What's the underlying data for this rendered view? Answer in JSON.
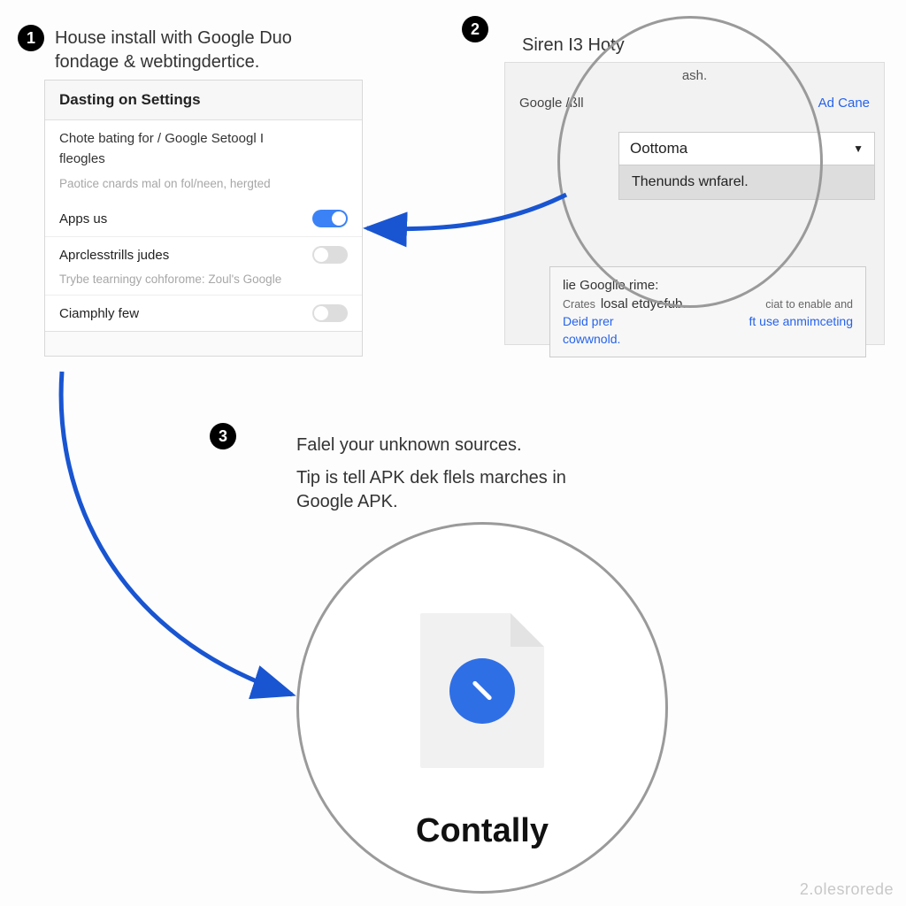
{
  "step1": {
    "badge": "1",
    "caption": "House install with Google Duo fondage & webtingdertice.",
    "panel_title": "Dasting on Settings",
    "line1": "Chote bating for / Google Setoogl I",
    "line2": "fleogles",
    "grey1": "Paotice cnards mal on fol/neen, hergted",
    "row_apps": "Apps us",
    "row_apr": "Aprclesstrills judes",
    "grey2": "Trybe tearningy cohforome: Zoul's Google",
    "row_ciam": "Ciamphly few"
  },
  "step2": {
    "badge": "2",
    "caption": "Siren I3 Hoty",
    "sub_ash": "ash.",
    "left_label": "Google /ßll",
    "right_link": "Ad Cane",
    "dropdown_value": "Oottoma",
    "dropdown_menu": "Thenunds wnfarel.",
    "box_title1": "lie Googlle rime:",
    "box_crates": "Crates",
    "box_title2": "losal etdyefub.",
    "box_enable": "ciat to enable and",
    "box_deid": "Deid prer",
    "box_link2": "ft use anmimceting",
    "box_cow": "cowwnold."
  },
  "step3": {
    "badge": "3",
    "caption_line1": "Falel your unknown sources.",
    "caption_line2": "Tip is tell APK dek flels marches in Google APK.",
    "icon_label": "Contally"
  },
  "watermark": "2.olesrorede"
}
